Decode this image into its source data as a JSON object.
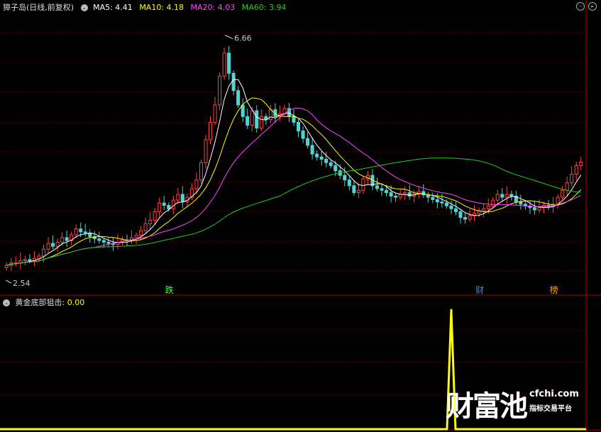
{
  "header": {
    "stock_name": "獐子岛(日线,前复权)",
    "ma5": "MA5: 4.41",
    "ma10": "MA10: 4.18",
    "ma20": "MA20: 4.03",
    "ma60": "MA60: 3.94"
  },
  "indicator_header": {
    "label": "黄金底部狙击",
    "value": ": 0.00"
  },
  "markers": [
    "跌",
    "财",
    "榜"
  ],
  "price_labels": {
    "high": "6.66",
    "low": "2.54"
  },
  "watermark": {
    "logo": "财富池",
    "site": "cfchi.com",
    "tagline": "指标交易平台"
  },
  "colors": {
    "up": "#ff4444",
    "down": "#54d2d2",
    "ma5": "#ffffff",
    "ma10": "#ffff00",
    "ma20": "#ff44ff",
    "ma60": "#22cc22",
    "grid": "#880000",
    "signal": "#ffff00"
  },
  "chart_data": {
    "type": "candlestick",
    "series": [
      {
        "name": "MA5",
        "value": 4.41
      },
      {
        "name": "MA10",
        "value": 4.18
      },
      {
        "name": "MA20",
        "value": 4.03
      },
      {
        "name": "MA60",
        "value": 3.94
      }
    ],
    "high": 6.66,
    "low": 2.54,
    "ylim": [
      2.3,
      7.0
    ],
    "closes": [
      2.62,
      2.66,
      2.66,
      2.7,
      2.72,
      2.7,
      2.74,
      2.78,
      2.9,
      3.0,
      2.95,
      3.02,
      3.1,
      3.05,
      3.15,
      3.25,
      3.2,
      3.18,
      3.12,
      3.08,
      3.05,
      3.02,
      3.0,
      2.98,
      3.02,
      3.06,
      3.05,
      3.1,
      3.14,
      3.22,
      3.34,
      3.4,
      3.55,
      3.7,
      3.66,
      3.6,
      3.75,
      3.85,
      3.72,
      3.8,
      3.95,
      4.1,
      4.4,
      4.8,
      5.1,
      5.4,
      5.9,
      6.3,
      5.95,
      5.65,
      5.4,
      5.2,
      5.05,
      5.3,
      5.0,
      5.2,
      5.15,
      5.32,
      5.2,
      5.25,
      5.34,
      5.2,
      5.1,
      4.95,
      4.82,
      4.7,
      4.55,
      4.5,
      4.46,
      4.4,
      4.35,
      4.26,
      4.18,
      4.1,
      4.0,
      3.88,
      3.92,
      4.12,
      4.18,
      4.0,
      3.95,
      3.92,
      3.88,
      3.82,
      3.8,
      3.85,
      3.88,
      3.82,
      3.86,
      3.9,
      3.84,
      3.8,
      3.76,
      3.72,
      3.7,
      3.65,
      3.6,
      3.55,
      3.45,
      3.42,
      3.48,
      3.52,
      3.56,
      3.6,
      3.65,
      3.75,
      3.85,
      3.8,
      3.85,
      3.82,
      3.72,
      3.68,
      3.65,
      3.62,
      3.58,
      3.62,
      3.66,
      3.64,
      3.68,
      3.8,
      3.92,
      4.05,
      4.2,
      4.35,
      4.41
    ],
    "indicator": {
      "name": "黄金底部狙击",
      "value": 0.0,
      "signal_bar_index": 96,
      "signal_value": 1
    }
  }
}
